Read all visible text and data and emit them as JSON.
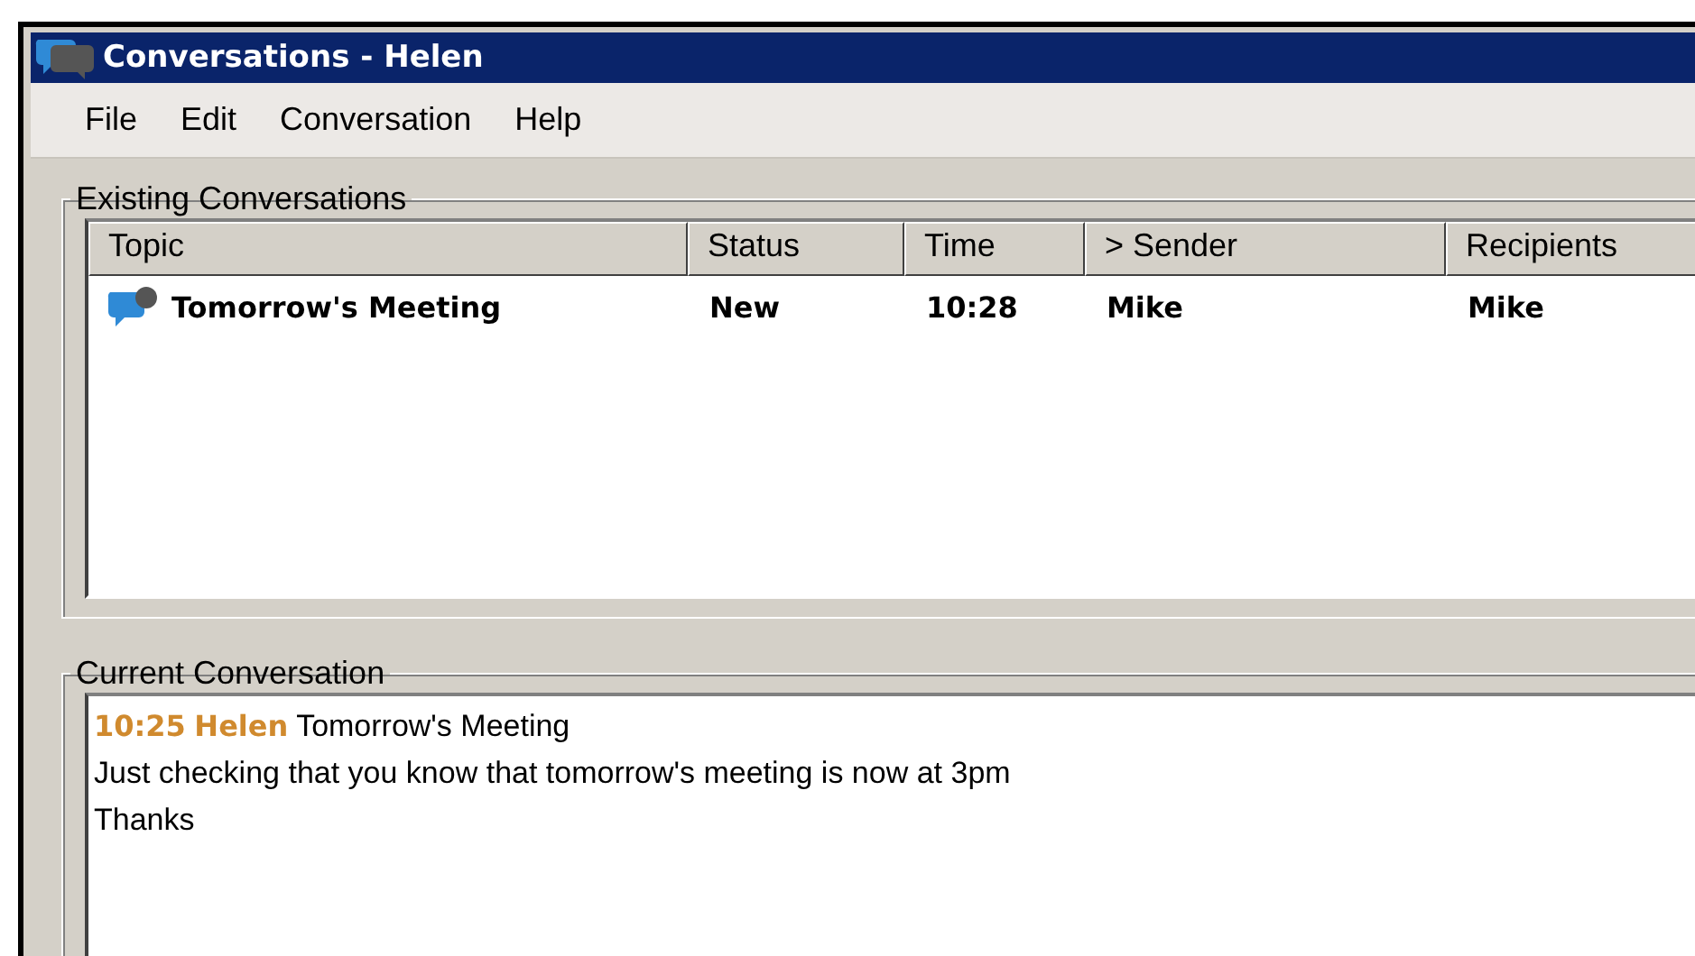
{
  "window": {
    "title": "Conversations - Helen"
  },
  "menu": [
    "File",
    "Edit",
    "Conversation",
    "Help"
  ],
  "existing": {
    "title": "Existing Conversations",
    "columns": [
      {
        "label": "Topic"
      },
      {
        "label": "Status"
      },
      {
        "label": "Time"
      },
      {
        "label": "> Sender"
      },
      {
        "label": "Recipients"
      }
    ],
    "rows": [
      {
        "unread": true,
        "cells": [
          "Tomorrow's Meeting",
          "New",
          "10:28",
          "Mike",
          "Mike"
        ]
      }
    ]
  },
  "current": {
    "title": "Current Conversation",
    "messages": [
      {
        "time": "10:25",
        "sender": "Helen",
        "subject": "Tomorrow's Meeting",
        "lines": [
          "Just checking that you know that tomorrow's meeting is now at 3pm",
          "Thanks"
        ]
      }
    ]
  }
}
